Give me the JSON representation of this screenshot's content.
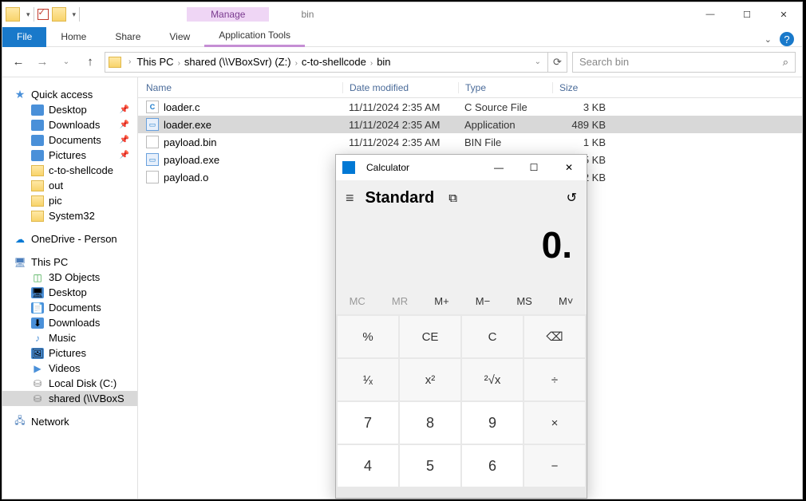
{
  "window": {
    "manage_tab": "Manage",
    "title": "bin"
  },
  "ribbon": {
    "file": "File",
    "tabs": [
      "Home",
      "Share",
      "View",
      "Application Tools"
    ]
  },
  "address": {
    "segments": [
      "This PC",
      "shared (\\\\VBoxSvr) (Z:)",
      "c-to-shellcode",
      "bin"
    ]
  },
  "search": {
    "placeholder": "Search bin"
  },
  "sidebar": {
    "quick_access": "Quick access",
    "quick_items": [
      {
        "label": "Desktop",
        "pinned": true,
        "icon": "desktop"
      },
      {
        "label": "Downloads",
        "pinned": true,
        "icon": "downloads"
      },
      {
        "label": "Documents",
        "pinned": true,
        "icon": "documents"
      },
      {
        "label": "Pictures",
        "pinned": true,
        "icon": "pictures"
      },
      {
        "label": "c-to-shellcode",
        "pinned": false,
        "icon": "folder"
      },
      {
        "label": "out",
        "pinned": false,
        "icon": "folder"
      },
      {
        "label": "pic",
        "pinned": false,
        "icon": "folder"
      },
      {
        "label": "System32",
        "pinned": false,
        "icon": "folder"
      }
    ],
    "onedrive": "OneDrive - Person",
    "this_pc": "This PC",
    "pc_items": [
      {
        "label": "3D Objects",
        "icon": "3d"
      },
      {
        "label": "Desktop",
        "icon": "desktop"
      },
      {
        "label": "Documents",
        "icon": "documents"
      },
      {
        "label": "Downloads",
        "icon": "downloads"
      },
      {
        "label": "Music",
        "icon": "music"
      },
      {
        "label": "Pictures",
        "icon": "pictures"
      },
      {
        "label": "Videos",
        "icon": "video"
      },
      {
        "label": "Local Disk (C:)",
        "icon": "drive"
      },
      {
        "label": "shared (\\\\VBoxS",
        "icon": "netdrive",
        "selected": true
      }
    ],
    "network": "Network"
  },
  "columns": {
    "name": "Name",
    "date": "Date modified",
    "type": "Type",
    "size": "Size"
  },
  "files": [
    {
      "name": "loader.c",
      "date": "11/11/2024 2:35 AM",
      "type": "C Source File",
      "size": "3 KB",
      "icon": "c",
      "selected": false
    },
    {
      "name": "loader.exe",
      "date": "11/11/2024 2:35 AM",
      "type": "Application",
      "size": "489 KB",
      "icon": "exe",
      "selected": true
    },
    {
      "name": "payload.bin",
      "date": "11/11/2024 2:35 AM",
      "type": "BIN File",
      "size": "1 KB",
      "icon": "bin",
      "selected": false
    },
    {
      "name": "payload.exe",
      "date": "",
      "type": "",
      "size": "5 KB",
      "icon": "exe",
      "selected": false
    },
    {
      "name": "payload.o",
      "date": "",
      "type": "",
      "size": "2 KB",
      "icon": "bin",
      "selected": false
    }
  ],
  "calc": {
    "title": "Calculator",
    "mode": "Standard",
    "display": "0.",
    "memory": [
      "MC",
      "MR",
      "M+",
      "M−",
      "MS",
      "M˅"
    ],
    "memory_enabled": [
      false,
      false,
      true,
      true,
      true,
      true
    ],
    "buttons": [
      {
        "l": "%",
        "n": false
      },
      {
        "l": "CE",
        "n": false
      },
      {
        "l": "C",
        "n": false
      },
      {
        "l": "⌫",
        "n": false
      },
      {
        "l": "¹⁄ₓ",
        "n": false
      },
      {
        "l": "x²",
        "n": false
      },
      {
        "l": "²√x",
        "n": false
      },
      {
        "l": "÷",
        "n": false
      },
      {
        "l": "7",
        "n": true
      },
      {
        "l": "8",
        "n": true
      },
      {
        "l": "9",
        "n": true
      },
      {
        "l": "×",
        "n": false
      },
      {
        "l": "4",
        "n": true
      },
      {
        "l": "5",
        "n": true
      },
      {
        "l": "6",
        "n": true
      },
      {
        "l": "−",
        "n": false
      }
    ]
  }
}
